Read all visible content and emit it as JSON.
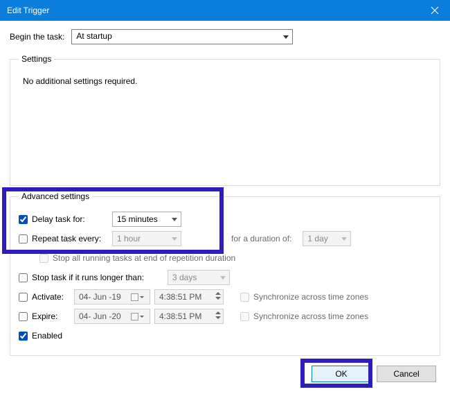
{
  "titlebar": {
    "title": "Edit Trigger"
  },
  "begin": {
    "label": "Begin the task:",
    "value": "At startup"
  },
  "settings_group": {
    "legend": "Settings",
    "text": "No additional settings required."
  },
  "advanced": {
    "legend": "Advanced settings",
    "delay_label": "Delay task for:",
    "delay_value": "15 minutes",
    "repeat_label": "Repeat task every:",
    "repeat_value": "1 hour",
    "duration_label": "for a duration of:",
    "duration_value": "1 day",
    "stop_repetition_label": "Stop all running tasks at end of repetition duration",
    "stop_if_label": "Stop task if it runs longer than:",
    "stop_if_value": "3 days",
    "activate_label": "Activate:",
    "activate_date": "04- Jun -19",
    "activate_time": "4:38:51 PM",
    "expire_label": "Expire:",
    "expire_date": "04- Jun -20",
    "expire_time": "4:38:51 PM",
    "sync_label": "Synchronize across time zones",
    "enabled_label": "Enabled"
  },
  "buttons": {
    "ok": "OK",
    "cancel": "Cancel"
  }
}
